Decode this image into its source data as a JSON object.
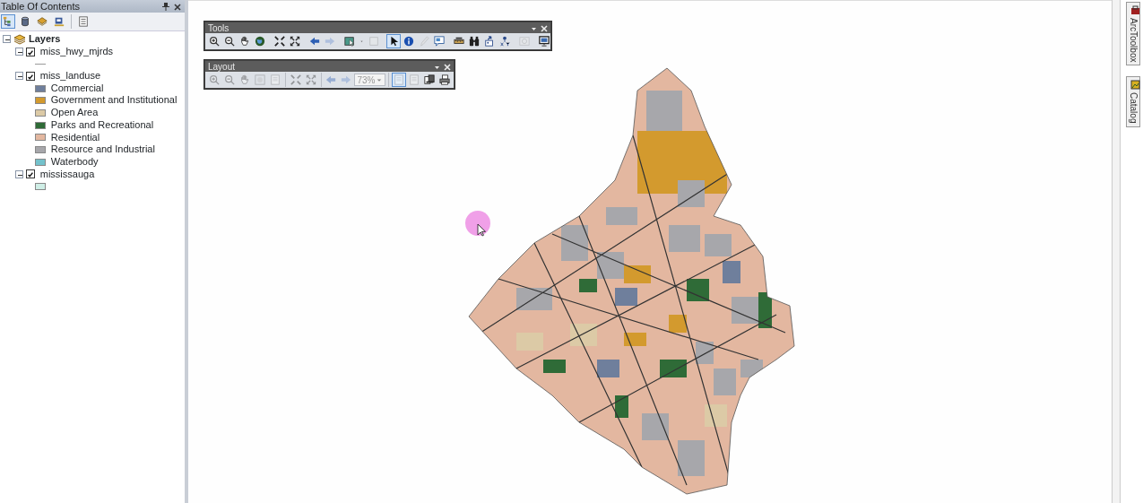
{
  "toc": {
    "title": "Table Of Contents",
    "tools": [
      {
        "kind": "list-by-drawing",
        "selected": true
      },
      {
        "kind": "list-by-source",
        "selected": false
      },
      {
        "kind": "list-by-visibility",
        "selected": false
      },
      {
        "kind": "list-by-selection",
        "selected": false
      },
      {
        "kind": "separator"
      },
      {
        "kind": "options",
        "selected": false
      }
    ],
    "root": {
      "label": "Layers",
      "expanded": true,
      "children": [
        {
          "label": "miss_hwy_mjrds",
          "checked": true,
          "expanded": true,
          "legend": [
            {
              "kind": "line",
              "color": "#9a9a9a"
            }
          ]
        },
        {
          "label": "miss_landuse",
          "checked": true,
          "expanded": true,
          "legend": [
            {
              "kind": "fill",
              "label": "Commercial",
              "color": "#6f7f9c"
            },
            {
              "kind": "fill",
              "label": "Government and Institutional",
              "color": "#d39a2e"
            },
            {
              "kind": "fill",
              "label": "Open Area",
              "color": "#dccaa6"
            },
            {
              "kind": "fill",
              "label": "Parks and Recreational",
              "color": "#2f6b37"
            },
            {
              "kind": "fill",
              "label": "Residential",
              "color": "#e3b7a0"
            },
            {
              "kind": "fill",
              "label": "Resource and Industrial",
              "color": "#a7a7ab"
            },
            {
              "kind": "fill",
              "label": "Waterbody",
              "color": "#74c2cc"
            }
          ]
        },
        {
          "label": "mississauga",
          "checked": true,
          "expanded": true,
          "legend": [
            {
              "kind": "fill",
              "color": "#cfeee6"
            }
          ]
        }
      ]
    }
  },
  "tools_toolbar": {
    "title": "Tools",
    "buttons": [
      {
        "kind": "zoom-in",
        "disabled": false,
        "selected": false
      },
      {
        "kind": "zoom-out",
        "disabled": false,
        "selected": false
      },
      {
        "kind": "pan",
        "disabled": false,
        "selected": false
      },
      {
        "kind": "globe",
        "disabled": false,
        "selected": false
      },
      {
        "kind": "separator"
      },
      {
        "kind": "fixed-in",
        "disabled": false,
        "selected": false
      },
      {
        "kind": "fixed-out",
        "disabled": false,
        "selected": false
      },
      {
        "kind": "separator"
      },
      {
        "kind": "back",
        "disabled": false,
        "selected": false
      },
      {
        "kind": "forward",
        "disabled": true,
        "selected": false
      },
      {
        "kind": "separator"
      },
      {
        "kind": "select-map",
        "disabled": false,
        "selected": false
      },
      {
        "kind": "caret",
        "disabled": false,
        "selected": false
      },
      {
        "kind": "clear",
        "disabled": true,
        "selected": false
      },
      {
        "kind": "separator"
      },
      {
        "kind": "pointer",
        "disabled": false,
        "selected": true
      },
      {
        "kind": "info",
        "disabled": false,
        "selected": false
      },
      {
        "kind": "pencil",
        "disabled": true,
        "selected": false
      },
      {
        "kind": "popup",
        "disabled": false,
        "selected": false
      },
      {
        "kind": "separator"
      },
      {
        "kind": "ruler",
        "disabled": false,
        "selected": false
      },
      {
        "kind": "binoculars",
        "disabled": false,
        "selected": false
      },
      {
        "kind": "goto",
        "disabled": false,
        "selected": false
      },
      {
        "kind": "xy",
        "disabled": false,
        "selected": false
      },
      {
        "kind": "separator"
      },
      {
        "kind": "clock",
        "disabled": true,
        "selected": false
      },
      {
        "kind": "separator"
      },
      {
        "kind": "viewer",
        "disabled": false,
        "selected": false
      }
    ]
  },
  "layout_toolbar": {
    "title": "Layout",
    "buttons": [
      {
        "kind": "zoom-in",
        "disabled": true,
        "selected": false
      },
      {
        "kind": "zoom-out",
        "disabled": true,
        "selected": false
      },
      {
        "kind": "pan",
        "disabled": true,
        "selected": false
      },
      {
        "kind": "full",
        "disabled": true,
        "selected": false
      },
      {
        "kind": "page",
        "disabled": true,
        "selected": false
      },
      {
        "kind": "separator"
      },
      {
        "kind": "fixed-in",
        "disabled": true,
        "selected": false
      },
      {
        "kind": "fixed-out",
        "disabled": true,
        "selected": false
      },
      {
        "kind": "separator"
      },
      {
        "kind": "back",
        "disabled": true,
        "selected": false
      },
      {
        "kind": "forward",
        "disabled": true,
        "selected": false
      },
      {
        "kind": "zoom-combo",
        "value": "73%",
        "disabled": true
      },
      {
        "kind": "separator"
      },
      {
        "kind": "page",
        "disabled": true,
        "selected": true
      },
      {
        "kind": "page",
        "disabled": true,
        "selected": false
      },
      {
        "kind": "layout-change",
        "disabled": false,
        "selected": false
      },
      {
        "kind": "print",
        "disabled": false,
        "selected": false
      }
    ]
  },
  "side_tabs": [
    {
      "kind": "toolbox",
      "label": "ArcToolbox",
      "selected": false
    },
    {
      "kind": "catalog",
      "label": "Catalog",
      "selected": false
    }
  ]
}
